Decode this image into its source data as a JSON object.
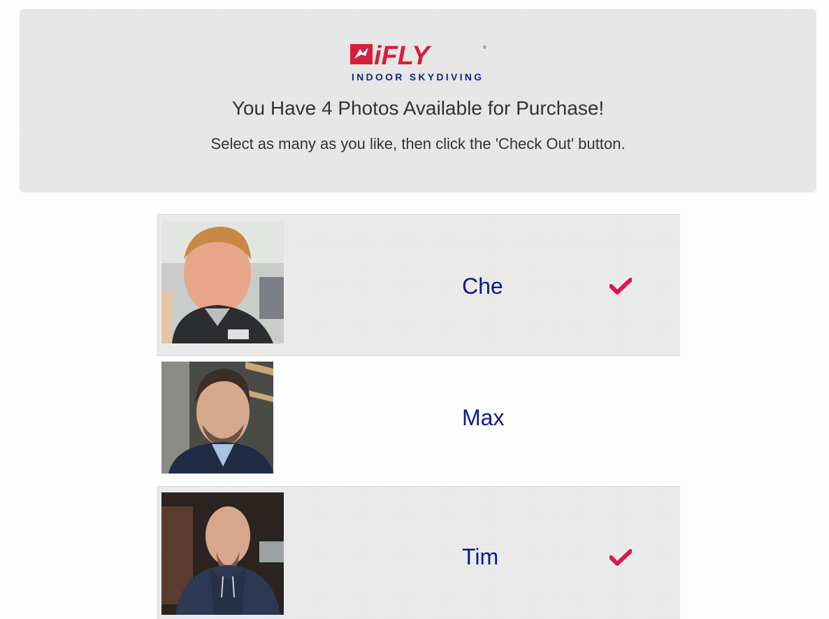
{
  "header": {
    "logo": {
      "brand": "iFLY",
      "tagline": "INDOOR SKYDIVING",
      "icon": "ifly-flyer-icon"
    },
    "title": "You Have 4 Photos Available for Purchase!",
    "subtitle": "Select as many as you like, then click the 'Check Out' button."
  },
  "photos": [
    {
      "name": "Che",
      "selected": true
    },
    {
      "name": "Max",
      "selected": false
    },
    {
      "name": "Tim",
      "selected": true
    }
  ],
  "colors": {
    "brand_red": "#d71f3c",
    "brand_navy": "#0b2a82",
    "name_text": "#0a1b8c",
    "check": "#d9184b"
  }
}
